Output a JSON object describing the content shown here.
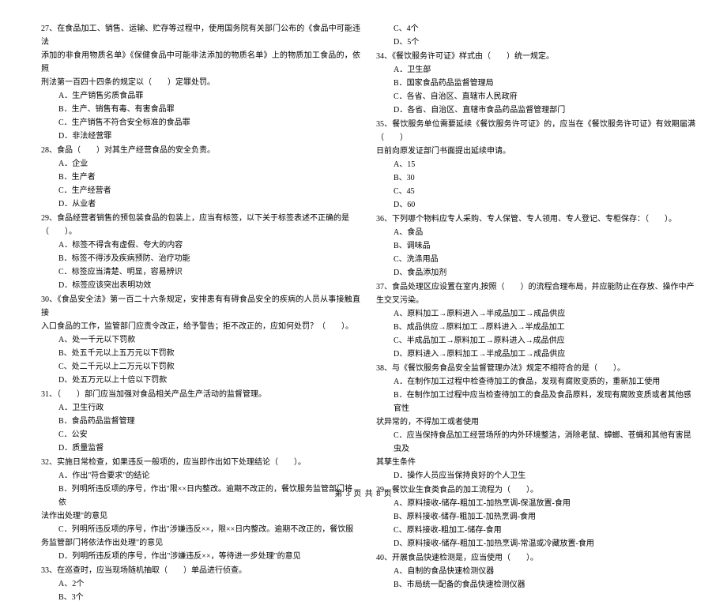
{
  "footer": "第 3 页 共 8 页",
  "left": {
    "q27": {
      "stem1": "27、在食品加工、销售、运输、贮存等过程中，使用国务院有关部门公布的《食品中可能违法",
      "stem2": "添加的非食用物质名单》《保健食品中可能非法添加的物质名单》上的物质加工食品的，依照",
      "stem3": "刑法第一百四十四条的规定以（　　）定罪处罚。",
      "a": "A．生产销售劣质食品罪",
      "b": "B．生产、销售有毒、有害食品罪",
      "c": "C．生产销售不符合安全标准的食品罪",
      "d": "D．非法经营罪"
    },
    "q28": {
      "stem": "28、食品（　　）对其生产经营食品的安全负责。",
      "a": "A．企业",
      "b": "B．生产者",
      "c": "C．生产经营者",
      "d": "D．从业者"
    },
    "q29": {
      "stem1": "29、食品经营者销售的预包装食品的包装上，应当有标签，以下关于标签表述不正确的是",
      "stem2": "（　　）。",
      "a": "A．标签不得含有虚假、夸大的内容",
      "b": "B．标签不得涉及疾病预防、治疗功能",
      "c": "C．标签应当清楚、明显，容易辨识",
      "d": "D．标签应该突出表明功效"
    },
    "q30": {
      "stem1": "30、《食品安全法》第一百二十六条规定，安排患有有碍食品安全的疾病的人员从事接触直接",
      "stem2": "入口食品的工作，监管部门应责令改正，给予警告；拒不改正的，应如何处罚？（　　）。",
      "a": "A、处一千元以下罚款",
      "b": "B、处五千元以上五万元以下罚款",
      "c": "C、处二千元以上二万元以下罚款",
      "d": "D、处五万元以上十倍以下罚款"
    },
    "q31": {
      "stem": "31、（　　）部门应当加强对食品相关产品生产活动的监督管理。",
      "a": "A．卫生行政",
      "b": "B．食品药品监督管理",
      "c": "C．公安",
      "d": "D．质量监督"
    },
    "q32": {
      "stem": "32、实施日常检查，如果违反一般项的，应当即作出如下处理结论（　　）。",
      "a": "A．作出\"符合要求\"的结论",
      "b1": "B．列明所违反项的序号，作出\"限××日内整改。逾期不改正的，餐饮服务监管部门将依",
      "b2": "法作出处理\"的意见",
      "c1": "C．列明所违反项的序号，作出\"涉嫌违反××，限××日内整改。逾期不改正的，餐饮服",
      "c2": "务监管部门将依法作出处理\"的意见",
      "d": "D．列明所违反项的序号，作出\"涉嫌违反××，等待进一步处理\"的意见"
    },
    "q33": {
      "stem": "33、在巡查时，应当现场随机抽取（　　）单品进行侦查。",
      "a": "A、2个",
      "b": "B、3个"
    }
  },
  "right": {
    "q33": {
      "c": "C、4个",
      "d": "D、5个"
    },
    "q34": {
      "stem": "34、《餐饮服务许可证》样式由（　　）统一规定。",
      "a": "A．卫生部",
      "b": "B．国家食品药品监督管理局",
      "c": "C．各省、自治区、直辖市人民政府",
      "d": "D．各省、自治区、直辖市食品药品监督管理部门"
    },
    "q35": {
      "stem1": "35、餐饮服务单位需要延续《餐饮服务许可证》的，应当在《餐饮服务许可证》有效期届满（　　）",
      "stem2": "日前向原发证部门书面提出延续申请。",
      "a": "A、15",
      "b": "B、30",
      "c": "C、45",
      "d": "D、60"
    },
    "q36": {
      "stem": "36、下列哪个物料应专人采购、专人保管、专人领用、专人登记、专柜保存：（　　）。",
      "a": "A、食品",
      "b": "B、调味品",
      "c": "C、洗涤用品",
      "d": "D、食品添加剂"
    },
    "q37": {
      "stem1": "37、食品处理区应设置在室内,按照（　　）的流程合理布局，并应能防止在存放、操作中产",
      "stem2": "生交叉污染。",
      "a": "A、原料加工→原料进入→半成品加工→成品供应",
      "b": "B、成品供应→原料加工→原料进入→半成品加工",
      "c": "C、半成品加工→原料加工→原料进入→成品供应",
      "d": "D、原料进入→原料加工→半成品加工→成品供应"
    },
    "q38": {
      "stem": "38、与《餐饮服务食品安全监督管理办法》规定不相符合的是（　　）。",
      "a": "A．在制作加工过程中检查待加工的食品，发现有腐败变质的，重新加工使用",
      "b1": "B．在制作加工过程中应当检查待加工的食品及食品原料，发现有腐败变质或者其他感官性",
      "b2": "状异常的，不得加工或者使用",
      "c1": "C．应当保持食品加工经营场所的内外环境整洁，消除老鼠、蟑螂、苍蝇和其他有害昆虫及",
      "c2": "其孳生条件",
      "d": "D．操作人员应当保持良好的个人卫生"
    },
    "q39": {
      "stem": "39、餐饮业生食类食品的加工流程为（　　）。",
      "a": "A、原料接收-储存-粗加工-加热烹调-保温放置-食用",
      "b": "B、原料接收-储存-粗加工-加热烹调-食用",
      "c": "C、原料接收-粗加工-储存-食用",
      "d": "D、原料接收-储存-粗加工-加热烹调-常温或冷藏放置-食用"
    },
    "q40": {
      "stem": "40、开展食品快速检测是，应当使用（　　）。",
      "a": "A、自制的食品快速检测仪器",
      "b": "B、市局统一配备的食品快速检测仪器"
    }
  }
}
